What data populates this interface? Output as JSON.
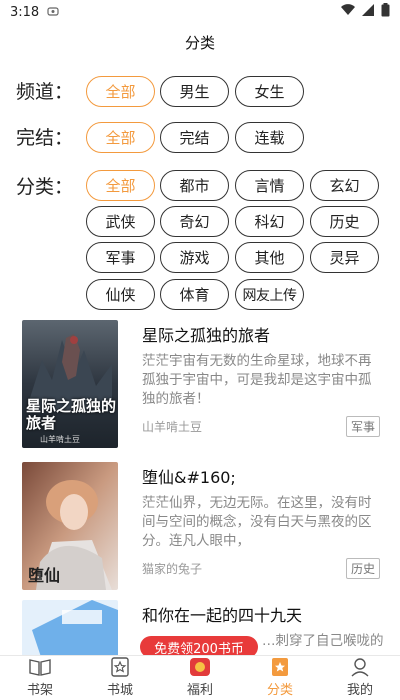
{
  "status_bar": {
    "time": "3:18"
  },
  "header": {
    "title": "分类"
  },
  "filters": {
    "channel": {
      "label": "频道：",
      "options": [
        "全部",
        "男生",
        "女生"
      ]
    },
    "completion": {
      "label": "完结：",
      "options": [
        "全部",
        "完结",
        "连载"
      ]
    },
    "category": {
      "label": "分类：",
      "options": [
        "全部",
        "都市",
        "言情",
        "玄幻",
        "武侠",
        "奇幻",
        "科幻",
        "历史",
        "军事",
        "游戏",
        "其他",
        "灵异",
        "仙侠",
        "体育",
        "网友上传"
      ]
    }
  },
  "books": [
    {
      "title": "星际之孤独的旅者",
      "description": "茫茫宇宙有无数的生命星球，地球不再孤独于宇宙中，可是我却是这宇宙中孤独的旅者！",
      "author": "山羊啃土豆",
      "tag": "军事",
      "cover_text_main": "星际之孤独的旅者",
      "cover_text_author": "山羊啃土豆"
    },
    {
      "title": "堕仙&#160;",
      "description": "茫茫仙界，无边无际。在这里，没有时间与空间的概念，没有白天与黑夜的区分。连凡人眼中，",
      "author": "猫家的兔子",
      "tag": "历史",
      "cover_text_main": "堕仙"
    },
    {
      "title": "和你在一起的四十九天",
      "description": "…刺穿了自己喉咙的",
      "author": "",
      "tag": ""
    }
  ],
  "promo": {
    "label": "免费领200书币"
  },
  "bottom_nav": [
    {
      "label": "书架",
      "icon": "book-icon"
    },
    {
      "label": "书城",
      "icon": "star-book-icon"
    },
    {
      "label": "福利",
      "icon": "gift-icon"
    },
    {
      "label": "分类",
      "icon": "category-icon"
    },
    {
      "label": "我的",
      "icon": "user-icon"
    }
  ],
  "colors": {
    "accent": "#f39a3e",
    "promo": "#e83a3a"
  }
}
